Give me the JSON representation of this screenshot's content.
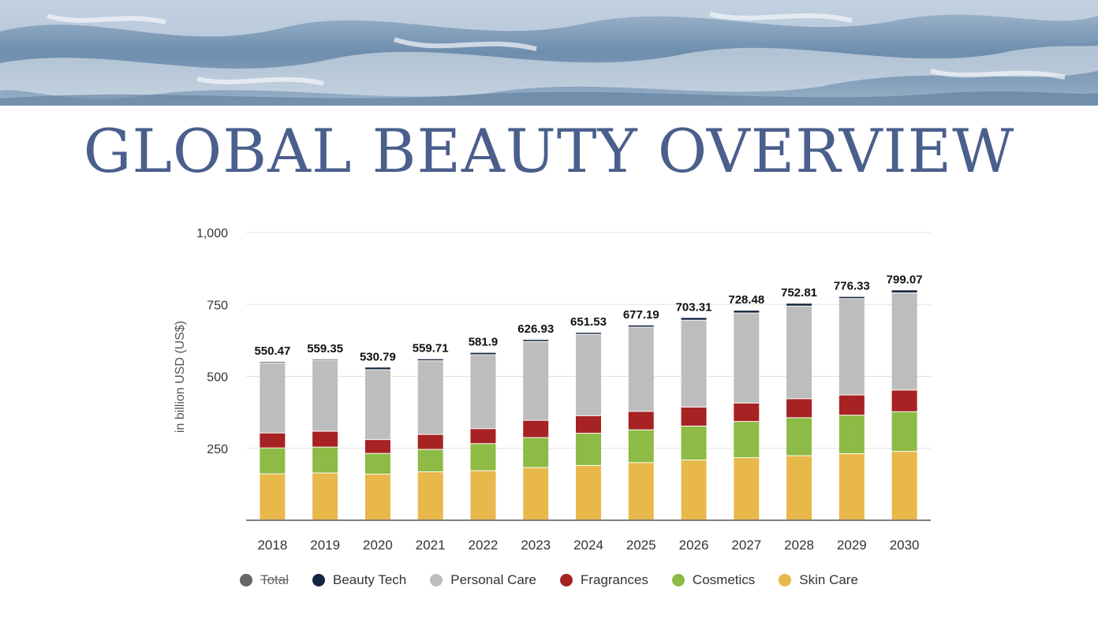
{
  "header": {
    "title": "GLOBAL BEAUTY OVERVIEW"
  },
  "chart_data": {
    "type": "bar",
    "stacked": true,
    "title": "",
    "xlabel": "",
    "ylabel": "in billion USD (US$)",
    "ylim": [
      0,
      1000
    ],
    "yticks": [
      250,
      500,
      750,
      1000
    ],
    "ytick_labels": [
      "250",
      "500",
      "750",
      "1,000"
    ],
    "grid": true,
    "legend_position": "bottom",
    "categories": [
      "2018",
      "2019",
      "2020",
      "2021",
      "2022",
      "2023",
      "2024",
      "2025",
      "2026",
      "2027",
      "2028",
      "2029",
      "2030"
    ],
    "totals": [
      550.47,
      559.35,
      530.79,
      559.71,
      581.9,
      626.93,
      651.53,
      677.19,
      703.31,
      728.48,
      752.81,
      776.33,
      799.07
    ],
    "total_labels": [
      "550.47",
      "559.35",
      "530.79",
      "559.71",
      "581.9",
      "626.93",
      "651.53",
      "677.19",
      "703.31",
      "728.48",
      "752.81",
      "776.33",
      "799.07"
    ],
    "series": [
      {
        "name": "Skin Care",
        "color": "#e8b84b",
        "values": [
          160,
          163,
          159,
          167,
          171,
          182,
          189,
          199,
          208,
          216,
          223,
          230,
          238
        ]
      },
      {
        "name": "Cosmetics",
        "color": "#8dbb45",
        "values": [
          90,
          90,
          72,
          78,
          94,
          104,
          112,
          114,
          118,
          126,
          132,
          134,
          138
        ]
      },
      {
        "name": "Fragrances",
        "color": "#a72222",
        "values": [
          52,
          55,
          48,
          52,
          52,
          60,
          61,
          64,
          66,
          64,
          66,
          70,
          75
        ]
      },
      {
        "name": "Personal Care",
        "color": "#bdbdbd",
        "values": [
          244,
          247,
          243,
          256,
          257,
          274,
          283,
          293,
          302,
          313,
          322,
          335,
          338
        ]
      },
      {
        "name": "Beauty Tech",
        "color": "#142640",
        "values": [
          4.47,
          4.35,
          8.79,
          6.71,
          7.9,
          6.93,
          6.53,
          7.19,
          9.31,
          9.48,
          9.81,
          7.33,
          10.07
        ]
      }
    ],
    "legend": [
      {
        "name": "Total",
        "color": "#666666",
        "hidden": true
      },
      {
        "name": "Beauty Tech",
        "color": "#142640"
      },
      {
        "name": "Personal Care",
        "color": "#bdbdbd"
      },
      {
        "name": "Fragrances",
        "color": "#a72222"
      },
      {
        "name": "Cosmetics",
        "color": "#8dbb45"
      },
      {
        "name": "Skin Care",
        "color": "#e8b84b"
      }
    ]
  }
}
